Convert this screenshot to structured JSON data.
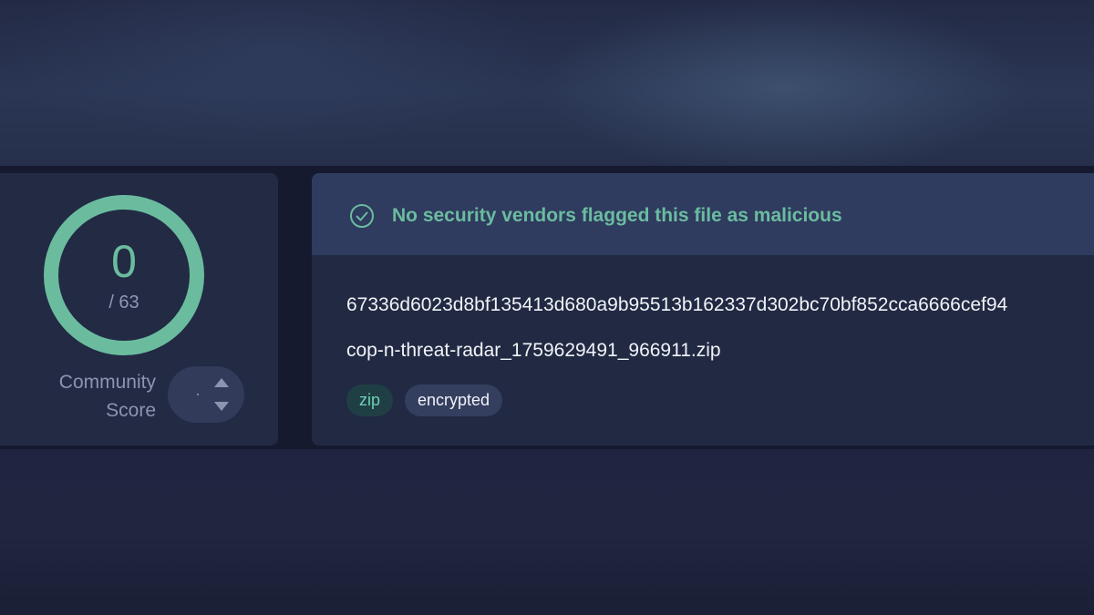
{
  "community_score": {
    "detections": "0",
    "total": "/ 63",
    "label_line1": "Community",
    "label_line2": "Score",
    "vote_value": "·",
    "detection_fraction": 0,
    "ring_color": "#6bbc9f",
    "icons": {
      "up": "chevron-up-icon",
      "down": "chevron-down-icon"
    }
  },
  "detection": {
    "verdict": "No security vendors flagged this file as malicious",
    "verdict_icon": "check-circle-icon",
    "verdict_color": "#6bbc9f"
  },
  "file": {
    "hash": "67336d6023d8bf135413d680a9b95513b162337d302bc70bf852cca6666cef94",
    "name": "cop-n-threat-radar_1759629491_966911.zip",
    "tags": [
      "zip",
      "encrypted"
    ]
  }
}
